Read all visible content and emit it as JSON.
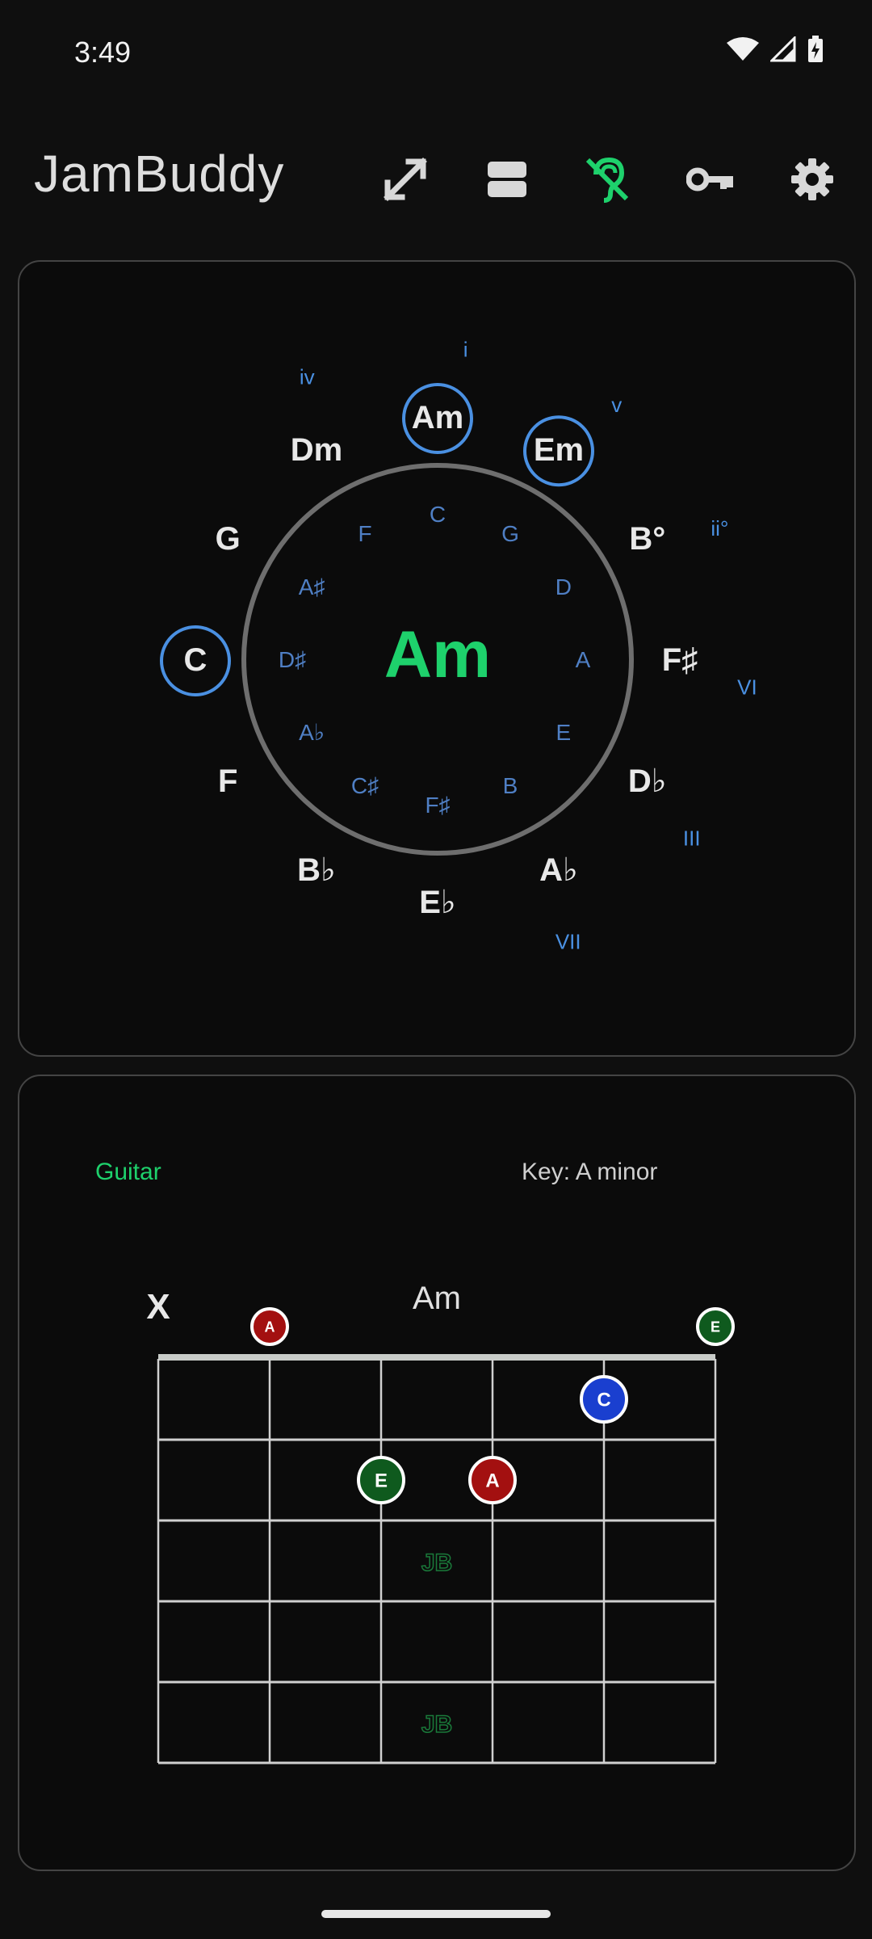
{
  "status": {
    "time": "3:49"
  },
  "app": {
    "title": "JamBuddy",
    "actions": [
      {
        "name": "expand-icon"
      },
      {
        "name": "layout-icon"
      },
      {
        "name": "hearing-off-icon",
        "accent": "#1ed16c"
      },
      {
        "name": "key-icon"
      },
      {
        "name": "settings-icon"
      }
    ]
  },
  "colors": {
    "accent_green": "#1ed16c",
    "blue": "#4a90e2",
    "red_dot": "#a31010",
    "green_dot": "#0f5a1e",
    "blue_dot": "#1a3fcf"
  },
  "circle": {
    "center": "Am",
    "outer": [
      {
        "chord": "Am",
        "roman": "i",
        "highlight": true
      },
      {
        "chord": "Em",
        "roman": "v",
        "highlight": true
      },
      {
        "chord": "B°",
        "roman": "ii°",
        "highlight": false
      },
      {
        "chord": "F♯",
        "roman": "VI",
        "highlight": false
      },
      {
        "chord": "D♭",
        "roman": "III",
        "highlight": false
      },
      {
        "chord": "A♭",
        "roman": "VII",
        "highlight": false
      },
      {
        "chord": "E♭",
        "roman": "",
        "highlight": false
      },
      {
        "chord": "B♭",
        "roman": "",
        "highlight": false
      },
      {
        "chord": "F",
        "roman": "",
        "highlight": false
      },
      {
        "chord": "C",
        "roman": "",
        "highlight": true
      },
      {
        "chord": "G",
        "roman": "",
        "highlight": false
      },
      {
        "chord": "Dm",
        "roman": "iv",
        "highlight": false
      }
    ],
    "inner": [
      "C",
      "G",
      "D",
      "A",
      "E",
      "B",
      "F♯",
      "C♯",
      "A♭",
      "D♯",
      "A♯",
      "F"
    ]
  },
  "fretboard": {
    "instrument": "Guitar",
    "key_label": "Key: A minor",
    "chord_name": "Am",
    "muted_label": "X",
    "open_notes": [
      {
        "string": 1,
        "note": "A",
        "color": "red"
      },
      {
        "string": 5,
        "note": "E",
        "color": "green"
      }
    ],
    "fretted_notes": [
      {
        "string": 4,
        "fret": 1,
        "note": "C",
        "color": "blue"
      },
      {
        "string": 2,
        "fret": 2,
        "note": "E",
        "color": "green"
      },
      {
        "string": 3,
        "fret": 2,
        "note": "A",
        "color": "red"
      }
    ],
    "watermarks": [
      "JB",
      "JB"
    ]
  }
}
